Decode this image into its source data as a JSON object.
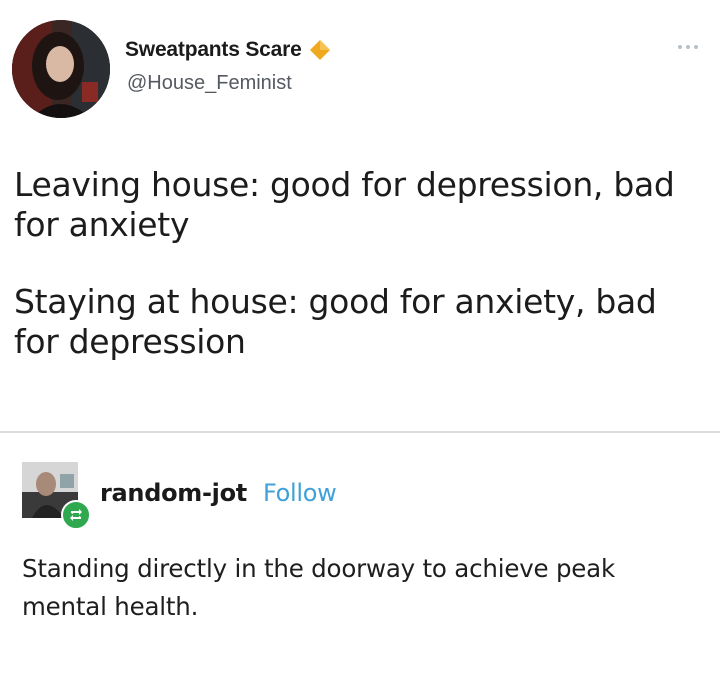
{
  "tweet": {
    "display_name": "Sweatpants Scare",
    "handle": "@House_Feminist",
    "verified_badge_icon": "diamond-badge-icon",
    "badge_color": "#F0A91E",
    "more_icon": "ellipsis-icon",
    "text_paragraphs": [
      "Leaving house: good for depression, bad for anxiety",
      "Staying at house: good for anxiety, bad for depression"
    ]
  },
  "reply": {
    "username": "random-jot",
    "follow_label": "Follow",
    "follow_color": "#3FA1D8",
    "badge_icon": "reblog-icon",
    "badge_color": "#2FA84F",
    "text": "Standing directly in the doorway to achieve peak mental health."
  }
}
